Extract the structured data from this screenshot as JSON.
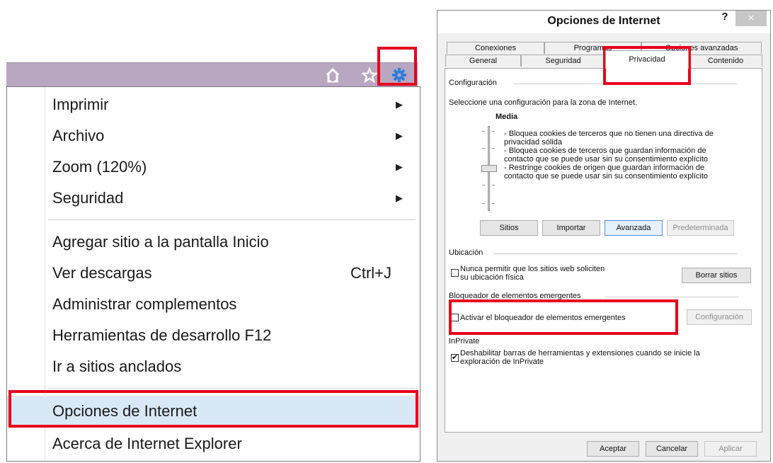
{
  "ie_menu": {
    "toolbar_icons": [
      "home-icon",
      "star-icon",
      "gear-icon"
    ],
    "items": [
      {
        "label": "Imprimir",
        "submenu": true
      },
      {
        "label": "Archivo",
        "submenu": true
      },
      {
        "label": "Zoom (120%)",
        "submenu": true
      },
      {
        "label": "Seguridad",
        "submenu": true
      },
      {
        "label": "Agregar sitio a la pantalla Inicio"
      },
      {
        "label": "Ver descargas",
        "shortcut": "Ctrl+J"
      },
      {
        "label": "Administrar complementos"
      },
      {
        "label": "Herramientas de desarrollo F12"
      },
      {
        "label": "Ir a sitios anclados"
      },
      {
        "label": "Opciones de Internet",
        "highlighted": true
      },
      {
        "label": "Acerca de Internet Explorer"
      }
    ],
    "submenu_arrow": "▶"
  },
  "dialog": {
    "title": "Opciones de Internet",
    "help_glyph": "?",
    "close_glyph": "×",
    "tabs_row1": [
      "Conexiones",
      "Programas",
      "Opciones avanzadas"
    ],
    "tabs_row2": [
      "General",
      "Seguridad",
      "Privacidad",
      "Contenido"
    ],
    "active_tab": "Privacidad",
    "configuracion": {
      "group_label": "Configuración",
      "intro": "Seleccione una configuración para la zona de Internet.",
      "level": "Media",
      "description": [
        "- Bloquea cookies de terceros que no tienen una directiva de",
        "privacidad sólida",
        "- Bloquea cookies de terceros que guardan información de",
        "contacto que se puede usar sin su consentimiento explícito",
        "- Restringe cookies de origen que guardan información de",
        "contacto que se puede usar sin su consentimiento explícito"
      ],
      "buttons": {
        "sitios": "Sitios",
        "importar": "Importar",
        "avanzada": "Avanzada",
        "predeterminada": "Predeterminada"
      }
    },
    "ubicacion": {
      "group_label": "Ubicación",
      "checkbox_line1": "Nunca permitir que los sitios web soliciten",
      "checkbox_line2": "su ubicación física",
      "checked": false,
      "button": "Borrar sitios"
    },
    "bloqueador": {
      "group_label": "Bloqueador de elementos emergentes",
      "checkbox_label": "Activar el bloqueador de elementos emergentes",
      "checked": false,
      "button": "Configuración"
    },
    "inprivate": {
      "group_label": "InPrivate",
      "checkbox_line1": "Deshabilitar barras de herramientas y extensiones cuando se inicie la",
      "checkbox_line2": "exploración de InPrivate",
      "checked": true,
      "check_glyph": "✔"
    },
    "footer": {
      "aceptar": "Aceptar",
      "cancelar": "Cancelar",
      "aplicar": "Aplicar"
    }
  }
}
